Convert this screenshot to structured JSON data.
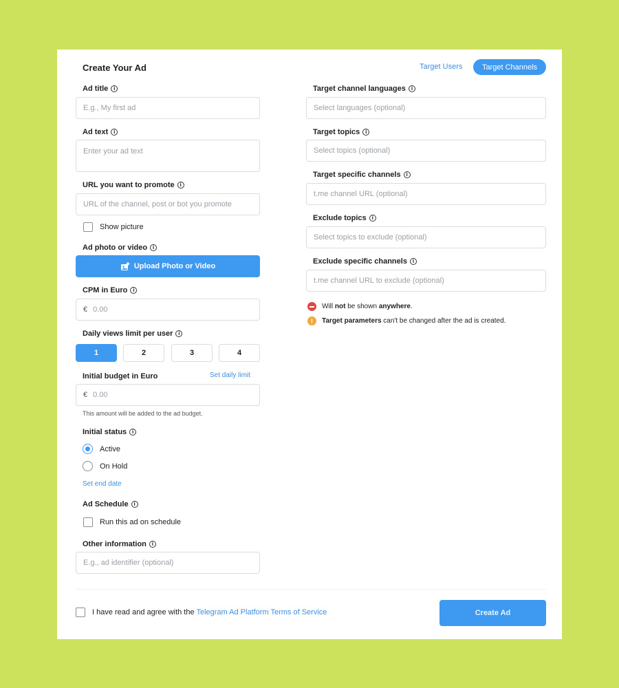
{
  "header": {
    "title": "Create Your Ad",
    "tab_target_users": "Target Users",
    "tab_target_channels": "Target Channels"
  },
  "left": {
    "ad_title": {
      "label": "Ad title",
      "placeholder": "E.g., My first ad"
    },
    "ad_text": {
      "label": "Ad text",
      "placeholder": "Enter your ad text"
    },
    "url": {
      "label": "URL you want to promote",
      "placeholder": "URL of the channel, post or bot you promote"
    },
    "show_picture": "Show picture",
    "media": {
      "label": "Ad photo or video",
      "button": "Upload Photo or Video"
    },
    "cpm": {
      "label": "CPM in Euro",
      "currency": "€",
      "placeholder": "0.00"
    },
    "daily_views": {
      "label": "Daily views limit per user",
      "options": [
        "1",
        "2",
        "3",
        "4"
      ],
      "selected": "1"
    },
    "budget": {
      "label": "Initial budget in Euro",
      "link": "Set daily limit",
      "currency": "€",
      "placeholder": "0.00",
      "hint": "This amount will be added to the ad budget."
    },
    "status": {
      "label": "Initial status",
      "options": [
        "Active",
        "On Hold"
      ],
      "selected": "Active",
      "end_date_link": "Set end date"
    },
    "schedule": {
      "label": "Ad Schedule",
      "checkbox": "Run this ad on schedule"
    },
    "other": {
      "label": "Other information",
      "placeholder": "E.g., ad identifier (optional)"
    }
  },
  "right": {
    "languages": {
      "label": "Target channel languages",
      "placeholder": "Select languages (optional)"
    },
    "topics": {
      "label": "Target topics",
      "placeholder": "Select topics (optional)"
    },
    "channels": {
      "label": "Target specific channels",
      "placeholder": "t.me channel URL (optional)"
    },
    "exclude_topics": {
      "label": "Exclude topics",
      "placeholder": "Select topics to exclude (optional)"
    },
    "exclude_channels": {
      "label": "Exclude specific channels",
      "placeholder": "t.me channel URL to exclude (optional)"
    },
    "notes": {
      "warning1_a": "Will ",
      "warning1_b": "not",
      "warning1_c": " be shown ",
      "warning1_d": "anywhere",
      "warning1_e": ".",
      "warning2_a": "Target parameters",
      "warning2_b": " can't be changed after the ad is created."
    }
  },
  "footer": {
    "terms_prefix": "I have read and agree with the ",
    "terms_link": "Telegram Ad Platform Terms of Service",
    "create_button": "Create Ad"
  },
  "colors": {
    "background": "#cce25d",
    "accent": "#3d9af0",
    "danger": "#e04848",
    "warning": "#f2a93b"
  }
}
